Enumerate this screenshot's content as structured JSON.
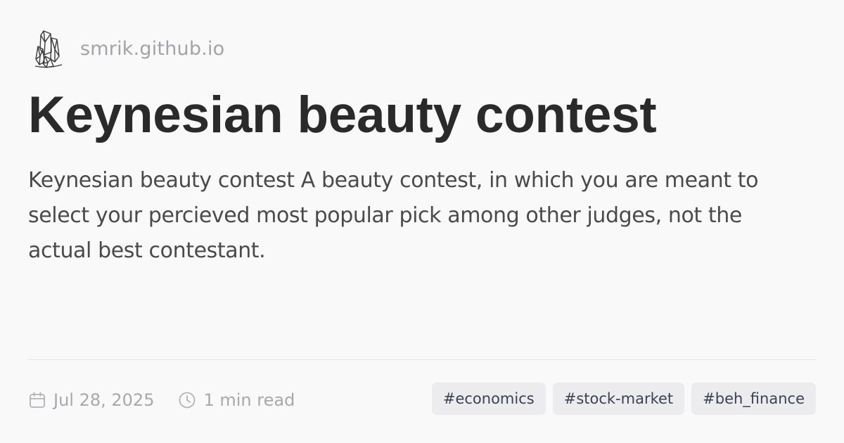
{
  "site": {
    "name": "smrik.github.io",
    "logo_icon": "crystal-icon"
  },
  "post": {
    "title": "Keynesian beauty contest",
    "description": "Keynesian beauty contest A beauty contest, in which you are meant to select your percieved most popular pick among other judges, not the actual best contestant.",
    "date": "Jul 28, 2025",
    "read_time": "1 min read",
    "date_icon": "calendar-icon",
    "read_time_icon": "clock-icon"
  },
  "tags": [
    "#economics",
    "#stock-market",
    "#beh_finance"
  ],
  "colors": {
    "background": "#f9f9fa",
    "title": "#2a2a2a",
    "muted": "#a8a8ad",
    "tag_background": "#ececee",
    "tag_text": "#3b4254"
  }
}
